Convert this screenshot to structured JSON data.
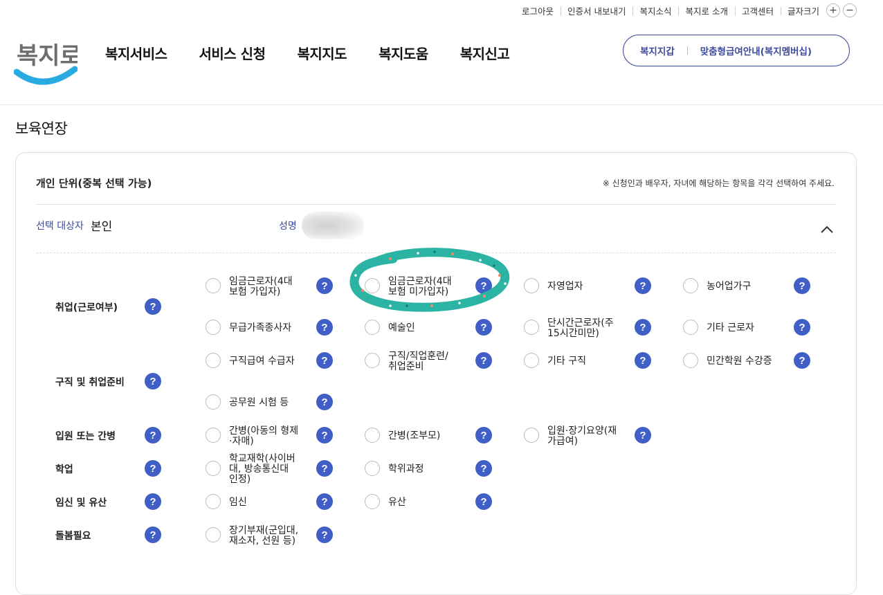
{
  "utility": {
    "logout": "로그아웃",
    "export_cert": "인증서 내보내기",
    "news": "복지소식",
    "about": "복지로 소개",
    "support": "고객센터",
    "font_size": "글자크기",
    "plus": "+",
    "minus": "−"
  },
  "header": {
    "logo_text": "복지로",
    "nav": [
      "복지서비스",
      "서비스 신청",
      "복지지도",
      "복지도움",
      "복지신고"
    ],
    "wallet": "복지지갑",
    "custom_guide": "맞춤형급여안내(복지멤버십)"
  },
  "page": {
    "title": "보육연장",
    "section_title": "개인 단위(중복 선택 가능)",
    "notice": "※ 신청인과 배우자, 자녀에 해당하는 항목을 각각 선택하여 주세요.",
    "target_label": "선택 대상자",
    "target_value": "본인",
    "name_label": "성명",
    "help_symbol": "?"
  },
  "rows": [
    {
      "label": "취업(근로여부)"
    },
    {
      "label": "구직 및 취업준비"
    },
    {
      "label": "입원 또는 간병"
    },
    {
      "label": "학업"
    },
    {
      "label": "임신 및 유산"
    },
    {
      "label": "돌봄필요"
    }
  ],
  "options": {
    "employment": [
      [
        "임금근로자(4대",
        "보험 가입자)"
      ],
      [
        "임금근로자(4대",
        "보험 미가입자)"
      ],
      [
        "자영업자"
      ],
      [
        "농어업가구"
      ],
      [
        "무급가족종사자"
      ],
      [
        "예술인"
      ],
      [
        "단시간근로자(주",
        "15시간미만)"
      ],
      [
        "기타 근로자"
      ]
    ],
    "job_seeking": [
      [
        "구직급여 수급자"
      ],
      [
        "구직/직업훈련/",
        "취업준비"
      ],
      [
        "기타 구직"
      ],
      [
        "민간학원 수강증"
      ],
      [
        "공무원 시험 등"
      ]
    ],
    "hospital": [
      [
        "간병(아동의 형제",
        "·자매)"
      ],
      [
        "간병(조부모)"
      ],
      [
        "입원·장기요양(재",
        "가급여)"
      ]
    ],
    "study": [
      [
        "학교재학(사이버",
        "대, 방송통신대",
        "인정)"
      ],
      [
        "학위과정"
      ]
    ],
    "pregnancy": [
      [
        "임신"
      ],
      [
        "유산"
      ]
    ],
    "care": [
      [
        "장기부재(군입대,",
        "재소자, 선원 등)"
      ]
    ]
  },
  "colors": {
    "brand": "#3c4a9e",
    "help": "#3f5ec6",
    "highlight": "#2bb3a3"
  }
}
